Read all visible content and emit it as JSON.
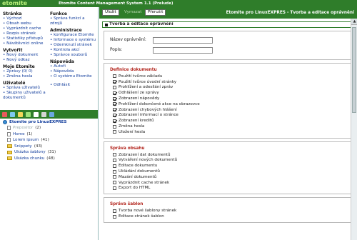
{
  "app": {
    "logo": "etomite",
    "title": "Etomite Content Management System 1.1 (Prelude)"
  },
  "leftmenu": {
    "col1": [
      {
        "title": "Stránka",
        "items": [
          "Výchozí",
          "Obsah webu",
          "Vyprázdnit cache",
          "Rozpis stránek",
          "Statistiky přístupů",
          "Návštěvníci online"
        ]
      },
      {
        "title": "Vytvořit",
        "items": [
          "Nový dokument",
          "Nový odkaz"
        ]
      },
      {
        "title": "Moje Etomite",
        "items": [
          "Zprávy (0/ 0)",
          "Změna hesla"
        ]
      },
      {
        "title": "Uživatelé",
        "items": [
          "Správa uživatelů",
          "Skupiny uživatelů a dokumentů"
        ]
      }
    ],
    "col2": [
      {
        "title": "Funkce",
        "items": [
          "Správa funkcí a zdrojů"
        ]
      },
      {
        "title": "Administrace",
        "items": [
          "konfigurace Etomite",
          "Informace o systému",
          "Odemknutí stránek",
          "Kontrola akcí",
          "Správce souborů"
        ]
      },
      {
        "title": "Nápověda",
        "items": [
          "Autoři",
          "Nápověda",
          "O systému Etomite"
        ]
      },
      {
        "title": "",
        "items": [
          "Odhlásit"
        ]
      }
    ]
  },
  "tree": {
    "root": "Etomite pro LinuxEXPRES",
    "nodes": [
      {
        "label": "Prepositor",
        "count": "(2)",
        "type": "page",
        "dim": true
      },
      {
        "label": "Home",
        "count": "(1)",
        "type": "page",
        "dim": false
      },
      {
        "label": "Lorem ipsum",
        "count": "(41)",
        "type": "page",
        "dim": false
      },
      {
        "label": "Snippety",
        "count": "(43)",
        "type": "folder",
        "dim": false
      },
      {
        "label": "Ukázka šablony",
        "count": "(31)",
        "type": "folder",
        "dim": false
      },
      {
        "label": "Ukázka chunku",
        "count": "(48)",
        "type": "folder",
        "dim": false
      }
    ]
  },
  "toolbar": {
    "save": "Uložit",
    "delete": "Vymazat",
    "cancel": "Přerušit"
  },
  "rightpanel": {
    "title": "Etomite pro LinuxEXPRES - Tvorba a editace oprávnění",
    "form_header": "Tvorba a editace oprávnění",
    "name_label": "Název oprávnění:",
    "name_value": "",
    "desc_label": "Popis:",
    "desc_value": ""
  },
  "sections": [
    {
      "title": "Definice dokumentu",
      "items": [
        {
          "label": "Použití tvůrce základu",
          "checked": false
        },
        {
          "label": "Použití tvůrce úvodní stránky",
          "checked": true
        },
        {
          "label": "Prohlížení a odesílání zpráv",
          "checked": false
        },
        {
          "label": "Odhlášení ze správy",
          "checked": true
        },
        {
          "label": "Zobrazení nápovědy",
          "checked": true
        },
        {
          "label": "Prohlížení dokončené akce na obrazovce",
          "checked": true
        },
        {
          "label": "Zobrazení chybových hlášení",
          "checked": true
        },
        {
          "label": "Zobrazení informací o stránce",
          "checked": true
        },
        {
          "label": "Zobrazení kreditů",
          "checked": true
        },
        {
          "label": "Změna hesla",
          "checked": false
        },
        {
          "label": "Uložení hesla",
          "checked": false
        }
      ]
    },
    {
      "title": "Správa obsahu",
      "items": [
        {
          "label": "Zobrazení dat dokumentů",
          "checked": false
        },
        {
          "label": "Vytváření nových dokumentů",
          "checked": false
        },
        {
          "label": "Editace dokumentu",
          "checked": false
        },
        {
          "label": "Ukládání dokumentů",
          "checked": false
        },
        {
          "label": "Mazání dokumentů",
          "checked": false
        },
        {
          "label": "Vyprázdnit cache stránek",
          "checked": false
        },
        {
          "label": "Export do HTML",
          "checked": false
        }
      ]
    },
    {
      "title": "Správa šablon",
      "items": [
        {
          "label": "Tvorba nové šablony stránek",
          "checked": false
        },
        {
          "label": "Editace stránek šablon",
          "checked": false
        }
      ]
    }
  ],
  "colors": {
    "brand_green": "#2f7d2a",
    "link_blue": "#123d9c",
    "section_red": "#b3261e"
  }
}
